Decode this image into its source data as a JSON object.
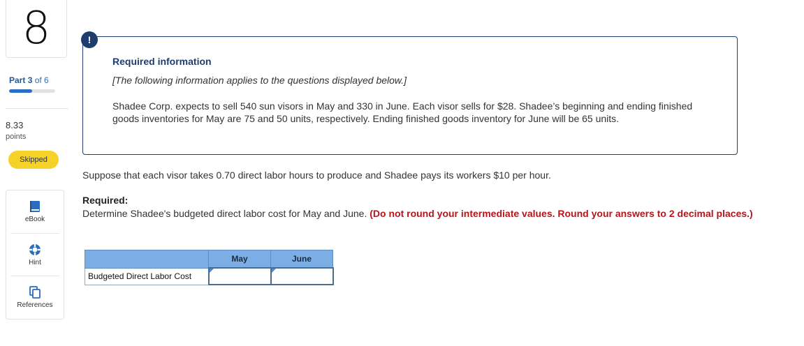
{
  "sidebar": {
    "question_number": "8",
    "part": {
      "prefix": "Part",
      "number": "3",
      "suffix": "of 6",
      "progress": 0.5
    },
    "points": {
      "value": "8.33",
      "label": "points"
    },
    "status_badge": "Skipped",
    "tools": [
      {
        "label": "eBook",
        "icon": "ebook-icon"
      },
      {
        "label": "Hint",
        "icon": "lifebuoy-icon"
      },
      {
        "label": "References",
        "icon": "references-icon"
      }
    ]
  },
  "info": {
    "alert_glyph": "!",
    "title": "Required information",
    "note": "[The following information applies to the questions displayed below.]",
    "text": "Shadee Corp. expects to sell 540 sun visors in May and 330 in June. Each visor sells for $28. Shadee’s beginning and ending finished goods inventories for May are 75 and 50 units, respectively. Ending finished goods inventory for June will be 65 units."
  },
  "question": {
    "text": "Suppose that each visor takes 0.70 direct labor hours to produce and Shadee pays its workers $10 per hour.",
    "required_label": "Required:",
    "required_text": "Determine Shadee's budgeted direct labor cost for May and June.",
    "instruction": "(Do not round your intermediate values. Round your answers to 2 decimal places.)"
  },
  "answer_table": {
    "columns": [
      "",
      "May",
      "June"
    ],
    "row_label": "Budgeted Direct Labor Cost",
    "values": {
      "may": "",
      "june": ""
    }
  },
  "colors": {
    "accent": "#1e3d6e",
    "progress": "#2b6cc4",
    "badge": "#f6d128",
    "header": "#7aaee4",
    "instruction_red": "#b3161b"
  }
}
